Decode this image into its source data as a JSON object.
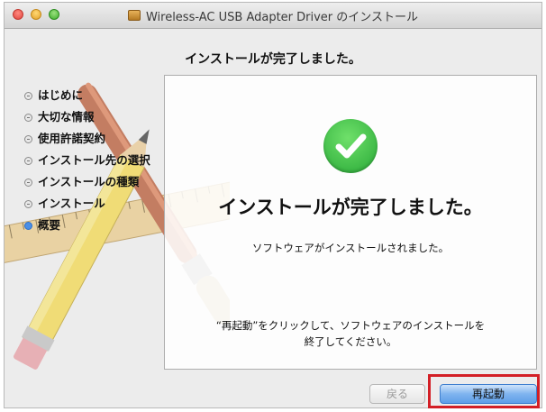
{
  "window": {
    "title": "Wireless-AC USB Adapter Driver のインストール",
    "icon": "package-icon"
  },
  "header": {
    "heading": "インストールが完了しました。"
  },
  "sidebar": {
    "steps": [
      {
        "label": "はじめに",
        "active": false
      },
      {
        "label": "大切な情報",
        "active": false
      },
      {
        "label": "使用許諾契約",
        "active": false
      },
      {
        "label": "インストール先の選択",
        "active": false
      },
      {
        "label": "インストールの種類",
        "active": false
      },
      {
        "label": "インストール",
        "active": false
      },
      {
        "label": "概要",
        "active": true
      }
    ]
  },
  "main": {
    "icon": "checkmark-icon",
    "title": "インストールが完了しました。",
    "message": "ソフトウェアがインストールされました。",
    "instruction_line1": "“再起動”をクリックして、ソフトウェアのインストールを",
    "instruction_line2": "終了してください。"
  },
  "buttons": {
    "back": "戻る",
    "restart": "再起動"
  },
  "colors": {
    "highlight": "#d31f26",
    "accent": "#5f9ee8",
    "success": "#27a836"
  }
}
